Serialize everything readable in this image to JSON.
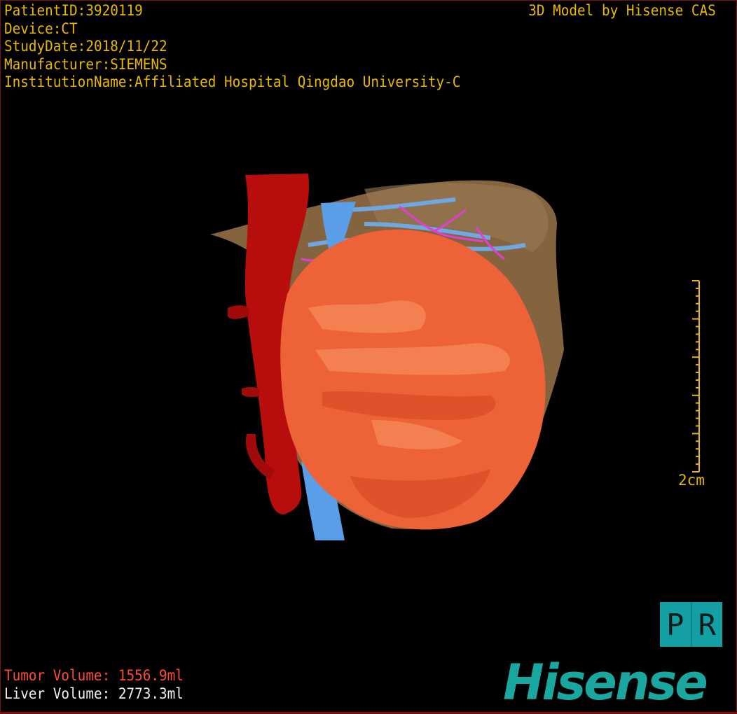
{
  "info": {
    "patient_id": "PatientID:3920119",
    "device": "Device:CT",
    "study_date": "StudyDate:2018/11/22",
    "manufacturer": "Manufacturer:SIEMENS",
    "institution": "InstitutionName:Affiliated Hospital Qingdao University-C"
  },
  "brand_caption": "3D Model by Hisense CAS",
  "volumes": {
    "tumor": "Tumor Volume: 1556.9ml",
    "liver": "Liver Volume: 2773.3ml"
  },
  "scale_bar": {
    "label": "2cm"
  },
  "orientation": {
    "left": "P",
    "right": "R"
  },
  "logo": "Hisense",
  "colors": {
    "text": "#e8b800",
    "tumor_text": "#ff4a3a",
    "liver": "#8a6a48",
    "tumor": "#f0643a",
    "artery": "#b80d0d",
    "vein": "#5a9ee8",
    "vessel_pink": "#e040d0",
    "logo": "#1aa7a0"
  }
}
